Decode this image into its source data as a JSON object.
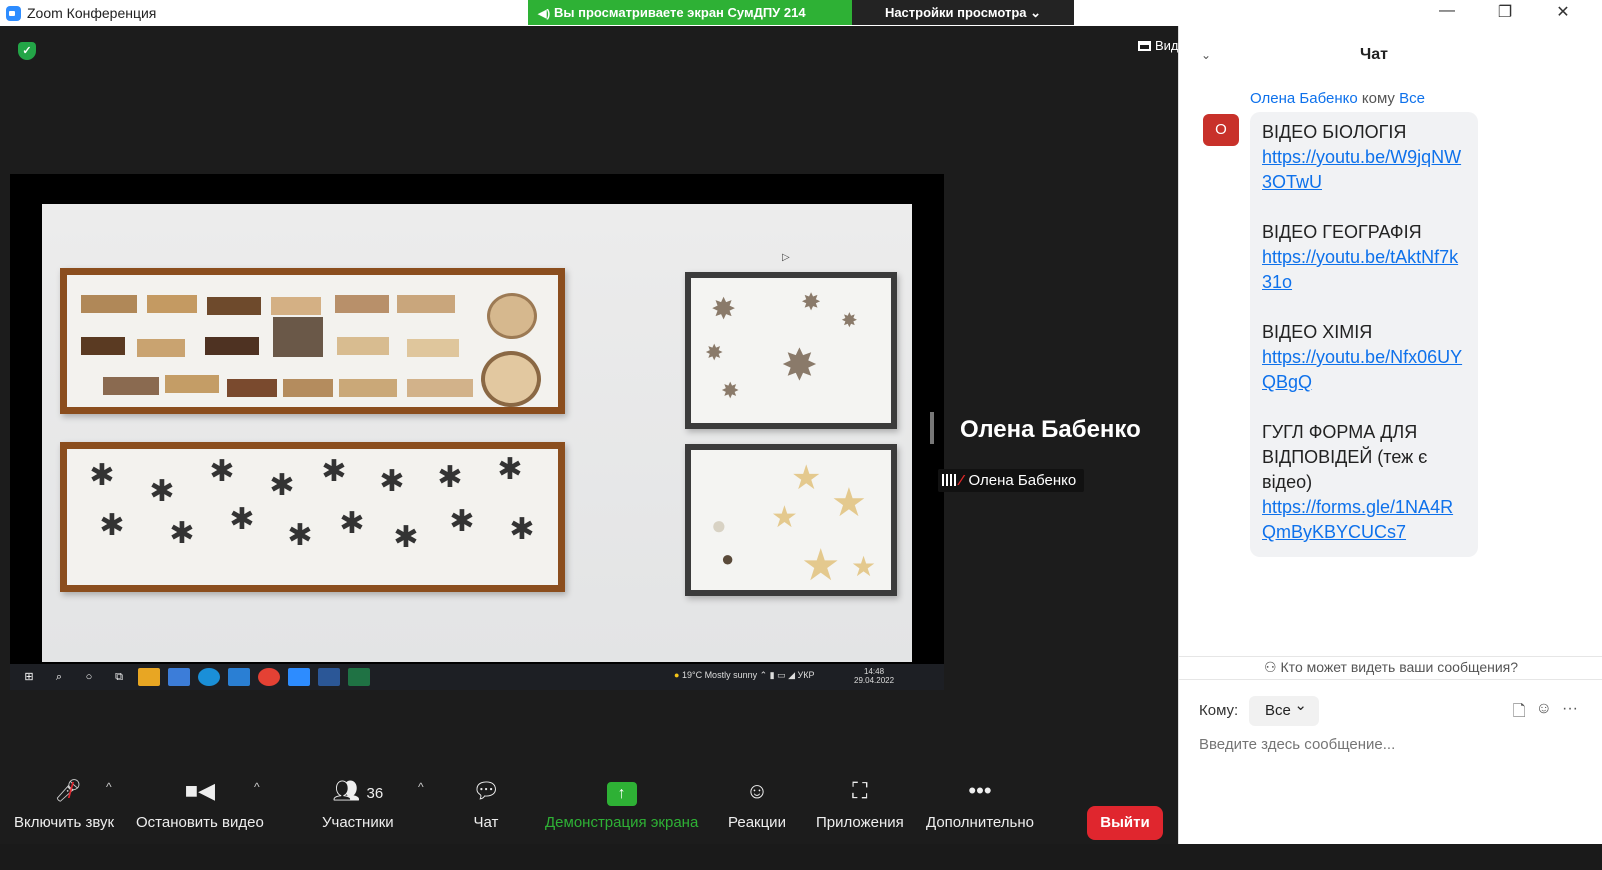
{
  "window": {
    "title": "Zoom Конференция",
    "share_banner": "Вы просматриваете экран СумДПУ 214",
    "view_options": "Настройки просмотра ⌄",
    "controls": {
      "minimize": "—",
      "restore": "❐",
      "close": "✕"
    }
  },
  "stage": {
    "view_label": "Вид",
    "spotlight_name": "Олена Бабенко",
    "participant_label": "Олена Бабенко"
  },
  "shared_taskbar": {
    "weather": "19°C  Mostly sunny",
    "tray": "⌃  ▮ ▭ ◢ УКР",
    "time": "14:48",
    "date": "29.04.2022"
  },
  "toolbar": {
    "mute": "Включить звук",
    "video": "Остановить видео",
    "participants": "Участники",
    "participants_count": "36",
    "chat": "Чат",
    "share": "Демонстрация экрана",
    "reactions": "Реакции",
    "apps": "Приложения",
    "more": "Дополнительно",
    "leave": "Выйти"
  },
  "chat": {
    "title": "Чат",
    "sender": "Олена Бабенко",
    "to_word": "кому",
    "recipient": "Все",
    "avatar_letter": "О",
    "messages": [
      {
        "label": "ВІДЕО БІОЛОГІЯ",
        "link": "https://youtu.be/W9jqNW3OTwU"
      },
      {
        "label": "ВІДЕО ГЕОГРАФІЯ",
        "link": "https://youtu.be/tAktNf7k31o"
      },
      {
        "label": "ВІДЕО ХІМІЯ",
        "link": "https://youtu.be/Nfx06UYQBgQ"
      },
      {
        "label": "ГУГЛ ФОРМА ДЛЯ ВІДПОВІДЕЙ (теж є відео)",
        "link": "https://forms.gle/1NA4RQmByKBYCUCs7"
      }
    ],
    "who_can_see": "Кто может видеть ваши сообщения?",
    "to_label": "Кому:",
    "to_value": "Все",
    "input_placeholder": "Введите здесь сообщение..."
  },
  "colors": {
    "accent_green": "#2eb135",
    "leave_red": "#e0262e",
    "link_blue": "#0e71eb",
    "avatar_red": "#c8312a"
  }
}
